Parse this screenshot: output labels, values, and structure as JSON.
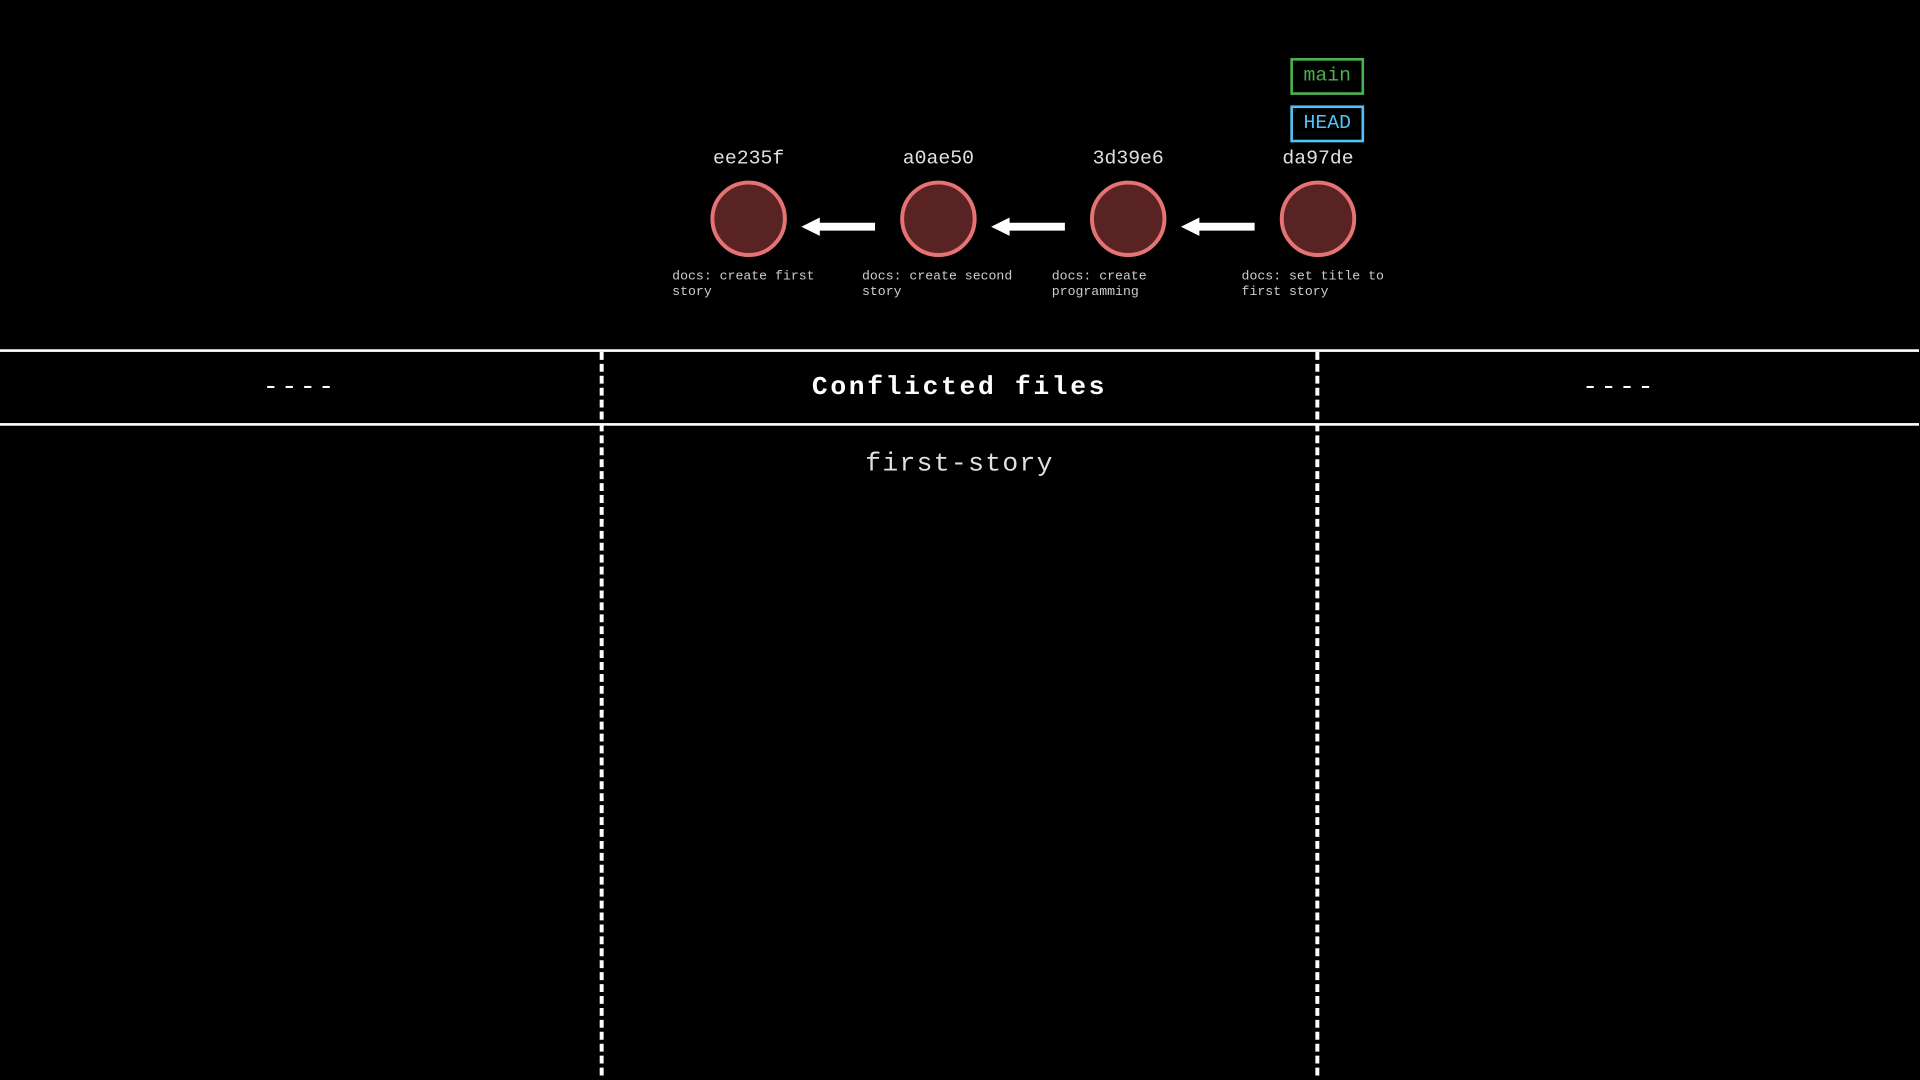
{
  "refs": {
    "branch": "main",
    "head": "HEAD"
  },
  "commits": [
    {
      "hash": "ee235f",
      "message": "docs: create first story"
    },
    {
      "hash": "a0ae50",
      "message": "docs: create second story"
    },
    {
      "hash": "3d39e6",
      "message": "docs: create programming"
    },
    {
      "hash": "da97de",
      "message": "docs: set title to first story"
    }
  ],
  "panel": {
    "left_header": "----",
    "mid_header": "Conflicted files",
    "right_header": "----",
    "files": [
      "first-story"
    ]
  },
  "colors": {
    "commit_fill": "#5a2323",
    "commit_stroke": "#e57373",
    "branch": "#4caf50",
    "head": "#4fc3f7"
  }
}
